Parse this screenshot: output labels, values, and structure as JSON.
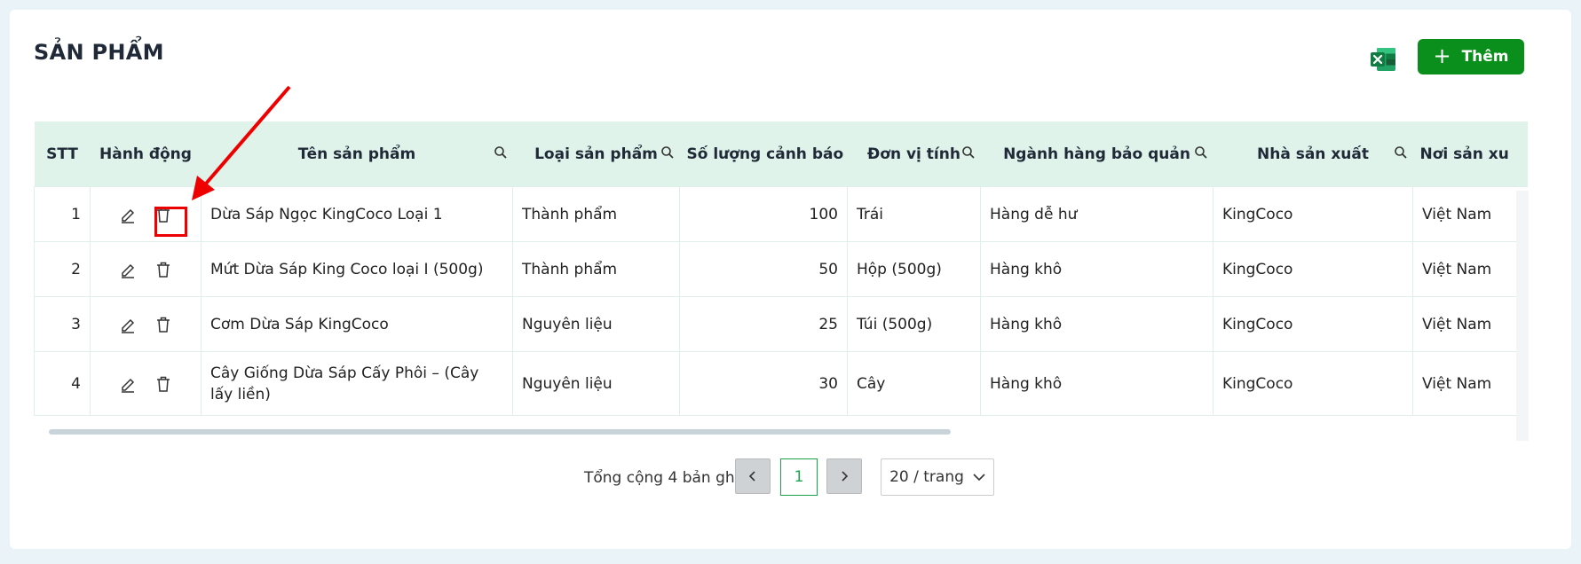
{
  "page": {
    "title": "SẢN PHẨM"
  },
  "toolbar": {
    "add_label": "Thêm",
    "excel_icon": "excel-icon"
  },
  "colors": {
    "accent": "#0b8f1c",
    "header_bg": "#dff3ea",
    "highlight": "#e00000"
  },
  "table": {
    "columns": [
      {
        "key": "stt",
        "label": "STT",
        "searchable": false
      },
      {
        "key": "actions",
        "label": "Hành động",
        "searchable": false
      },
      {
        "key": "name",
        "label": "Tên sản phẩm",
        "searchable": true
      },
      {
        "key": "type",
        "label": "Loại sản phẩm",
        "searchable": true
      },
      {
        "key": "warn_qty",
        "label": "Số lượng cảnh báo",
        "searchable": false
      },
      {
        "key": "unit",
        "label": "Đơn vị tính",
        "searchable": true
      },
      {
        "key": "storage",
        "label": "Ngành hàng bảo quản",
        "searchable": true
      },
      {
        "key": "maker",
        "label": "Nhà sản xuất",
        "searchable": true
      },
      {
        "key": "origin",
        "label": "Nơi sản xu",
        "searchable": false
      }
    ],
    "rows": [
      {
        "stt": "1",
        "name": "Dừa Sáp Ngọc KingCoco Loại 1",
        "type": "Thành phẩm",
        "warn_qty": "100",
        "unit": "Trái",
        "storage": "Hàng dễ hư",
        "maker": "KingCoco",
        "origin": "Việt Nam"
      },
      {
        "stt": "2",
        "name": "Mứt Dừa Sáp King Coco loại I (500g)",
        "type": "Thành phẩm",
        "warn_qty": "50",
        "unit": "Hộp (500g)",
        "storage": "Hàng khô",
        "maker": "KingCoco",
        "origin": "Việt Nam"
      },
      {
        "stt": "3",
        "name": "Cơm Dừa Sáp KingCoco",
        "type": "Nguyên liệu",
        "warn_qty": "25",
        "unit": "Túi (500g)",
        "storage": "Hàng khô",
        "maker": "KingCoco",
        "origin": "Việt Nam"
      },
      {
        "stt": "4",
        "name": "Cây Giống Dừa Sáp Cấy Phôi – (Cây lấy liền)",
        "type": "Nguyên liệu",
        "warn_qty": "30",
        "unit": "Cây",
        "storage": "Hàng khô",
        "maker": "KingCoco",
        "origin": "Việt Nam"
      }
    ]
  },
  "pagination": {
    "total_text": "Tổng cộng 4 bản ghi",
    "current_page": "1",
    "page_size": "20 / trang"
  }
}
